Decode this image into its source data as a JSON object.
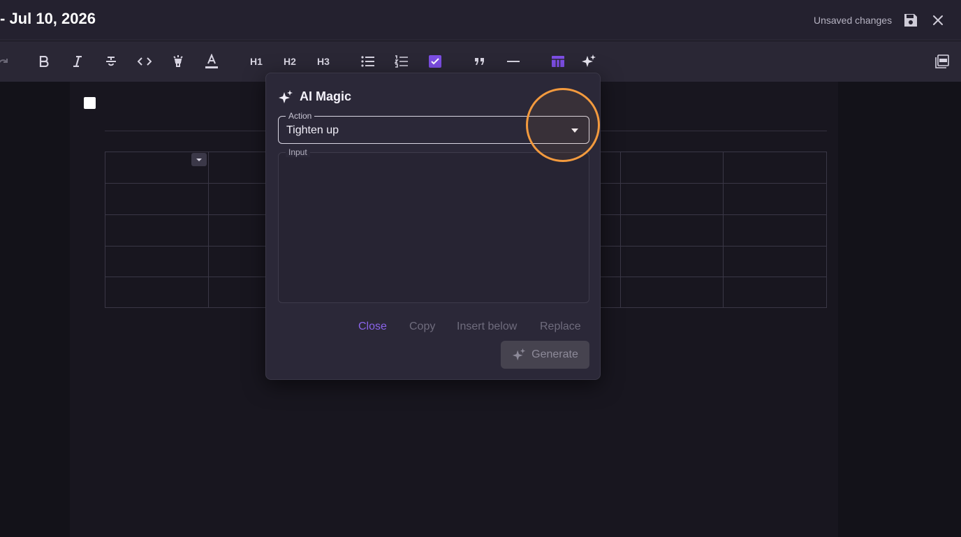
{
  "header": {
    "title": "- Jul 10, 2026",
    "status": "Unsaved changes",
    "save_icon": "save-icon",
    "close_icon": "close-icon"
  },
  "toolbar": {
    "items": [
      {
        "name": "redo-icon"
      },
      {
        "name": "bold-icon"
      },
      {
        "name": "italic-icon"
      },
      {
        "name": "strikethrough-icon"
      },
      {
        "name": "code-icon"
      },
      {
        "name": "highlight-icon"
      },
      {
        "name": "text-color-icon"
      },
      {
        "name": "heading-1",
        "label": "H1"
      },
      {
        "name": "heading-2",
        "label": "H2"
      },
      {
        "name": "heading-3",
        "label": "H3"
      },
      {
        "name": "bullet-list-icon"
      },
      {
        "name": "numbered-list-icon"
      },
      {
        "name": "checklist-icon"
      },
      {
        "name": "quote-icon"
      },
      {
        "name": "horizontal-rule-icon"
      },
      {
        "name": "table-icon"
      },
      {
        "name": "ai-magic-icon"
      },
      {
        "name": "export-pdf-icon"
      }
    ],
    "accent_color": "#7c4ee4"
  },
  "document": {
    "table": {
      "rows": 5,
      "columns": 7
    }
  },
  "dialog": {
    "title": "AI Magic",
    "action_label": "Action",
    "action_value": "Tighten up",
    "input_label": "Input",
    "input_value": "",
    "buttons": {
      "close": "Close",
      "copy": "Copy",
      "insert_below": "Insert below",
      "replace": "Replace",
      "generate": "Generate"
    },
    "accent_color": "#8a64ea"
  },
  "highlight": {
    "color": "#f39a3e"
  }
}
